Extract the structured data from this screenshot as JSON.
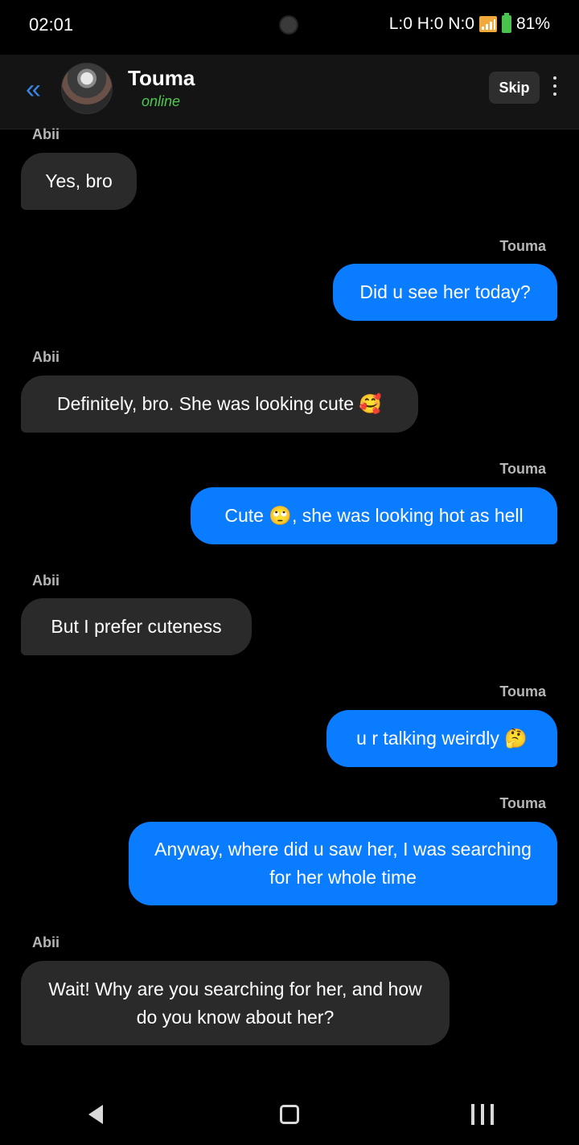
{
  "status_bar": {
    "time": "02:01",
    "network_text": "L:0 H:0 N:0",
    "battery": "81%",
    "icons": [
      "signal-icon",
      "battery-icon",
      "camera-dot"
    ]
  },
  "header": {
    "contact_name": "Touma",
    "contact_status": "online",
    "skip_label": "Skip",
    "back_symbol": "«",
    "icons": [
      "back-chevron-icon",
      "avatar",
      "more-vert-icon"
    ]
  },
  "messages": [
    {
      "sender": "Abii",
      "text": "Yes, bro",
      "direction": "in"
    },
    {
      "sender": "Touma",
      "text": "Did u see her today?",
      "direction": "out"
    },
    {
      "sender": "Abii",
      "text": "Definitely, bro. She was looking cute 🥰",
      "direction": "in"
    },
    {
      "sender": "Touma",
      "text": "Cute 🙄, she was looking hot as hell",
      "direction": "out"
    },
    {
      "sender": "Abii",
      "text": "But I prefer cuteness",
      "direction": "in"
    },
    {
      "sender": "Touma",
      "text": "u r talking weirdly 🤔",
      "direction": "out"
    },
    {
      "sender": "Touma",
      "text": "Anyway, where did u saw her, I was searching for her whole time",
      "direction": "out"
    },
    {
      "sender": "Abii",
      "text": "Wait! Why are you searching for her, and how do you know about her?",
      "direction": "in"
    }
  ],
  "nav_bar": {
    "icons": [
      "nav-back-icon",
      "nav-home-icon",
      "nav-recents-icon"
    ]
  },
  "colors": {
    "background": "#000000",
    "header": "#141414",
    "incoming_bubble": "#2a2a2a",
    "outgoing_bubble": "#0a7cff",
    "online_green": "#4fc84f",
    "back_accent": "#3a86e0"
  }
}
